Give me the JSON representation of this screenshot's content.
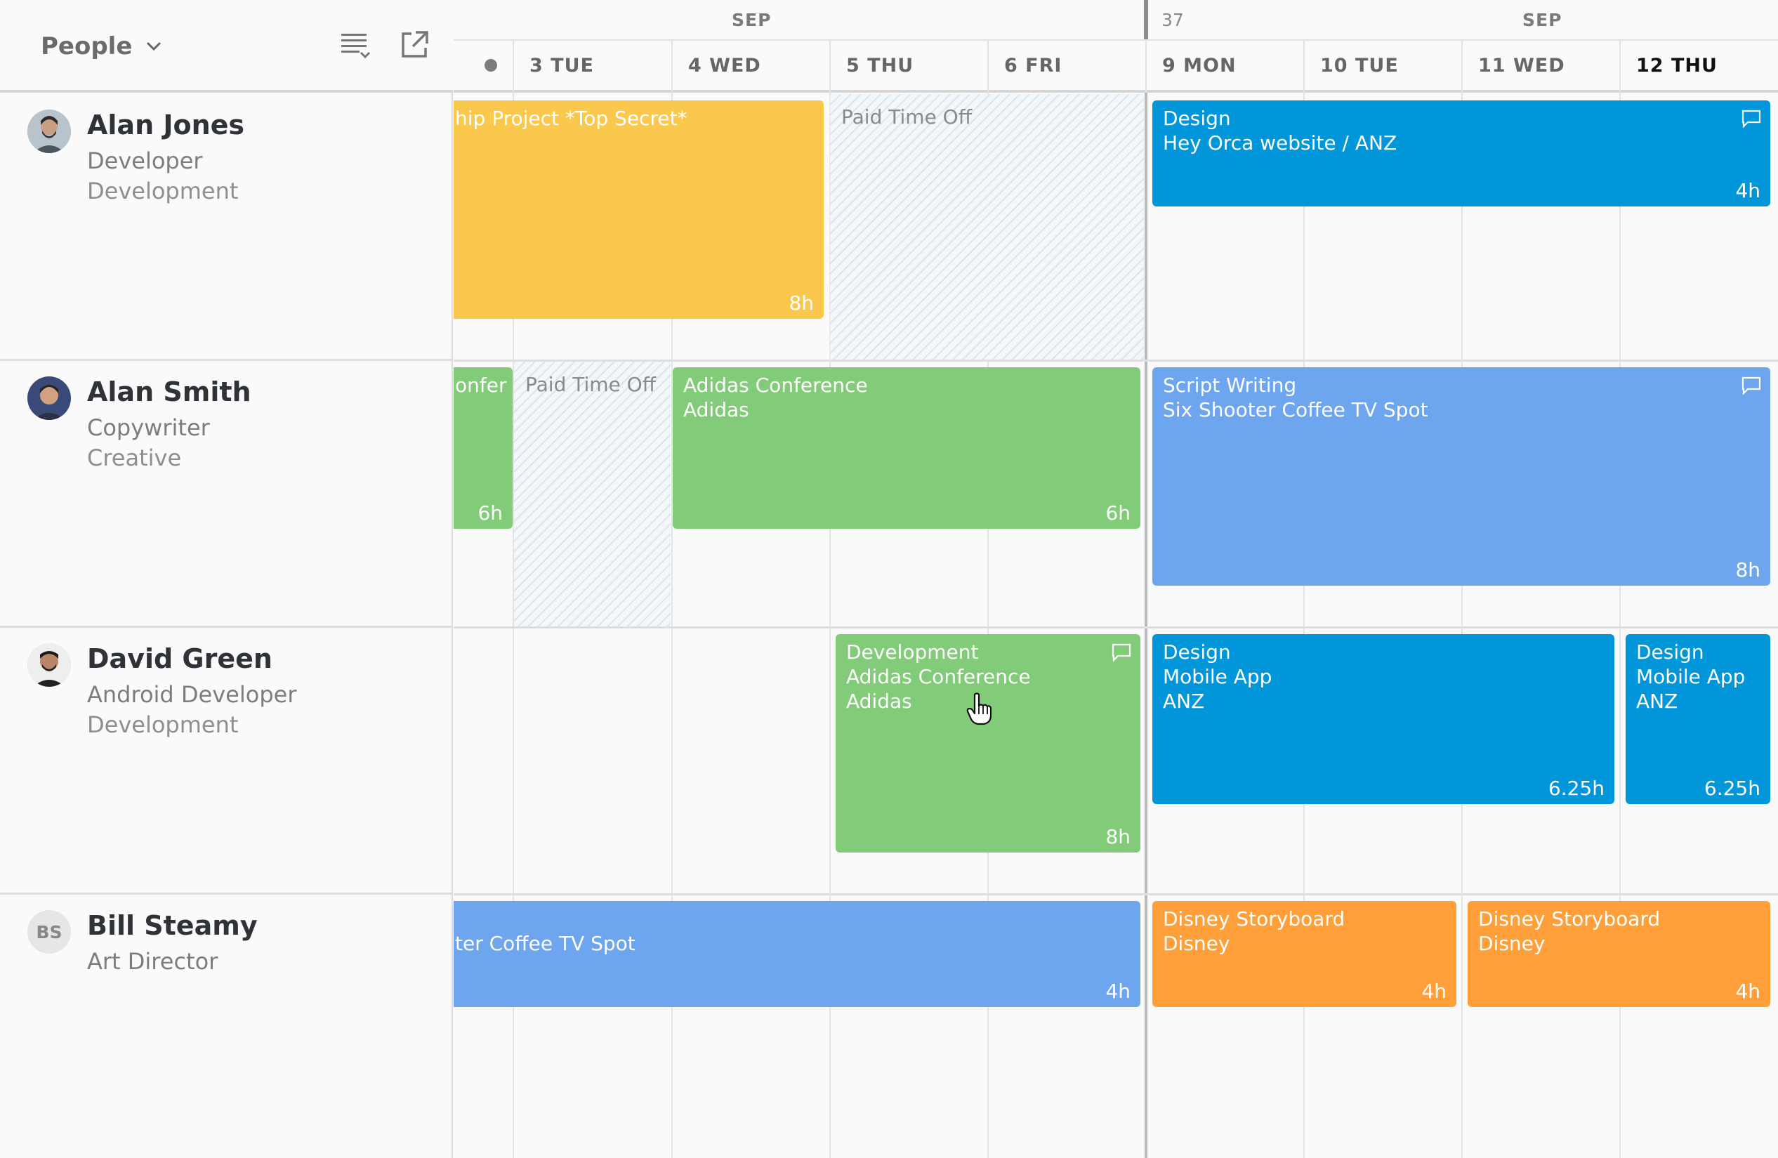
{
  "sidebar": {
    "view_select": "People",
    "people": [
      {
        "name": "Alan Jones",
        "role": "Developer",
        "department": "Development"
      },
      {
        "name": "Alan Smith",
        "role": "Copywriter",
        "department": "Creative"
      },
      {
        "name": "David Green",
        "role": "Android Developer",
        "department": "Development"
      },
      {
        "name": "Bill Steamy",
        "role": "Art Director",
        "initials": "BS"
      }
    ]
  },
  "header": {
    "month_left": "SEP",
    "month_right": "SEP",
    "week_number": "37",
    "days": [
      "3 TUE",
      "4 WED",
      "5 THU",
      "6 FRI",
      "9 MON",
      "10 TUE",
      "11 WED",
      "12 THU"
    ]
  },
  "tasks": {
    "jones_a": {
      "line1": "hip Project *Top Secret*",
      "hours": "8h"
    },
    "jones_pto": "Paid Time Off",
    "jones_b": {
      "line1": "Design",
      "line2": "Hey Orca website / ANZ",
      "hours": "4h"
    },
    "smith_a": {
      "line1": "onfer",
      "hours": "6h"
    },
    "smith_pto": "Paid Time Off",
    "smith_b": {
      "line1": "Adidas Conference",
      "line2": "Adidas",
      "hours": "6h"
    },
    "smith_c": {
      "line1": "Script Writing",
      "line2": "Six Shooter Coffee TV Spot",
      "hours": "8h"
    },
    "green_a": {
      "line1": "Development",
      "line2": "Adidas Conference",
      "line3": "Adidas",
      "hours": "8h"
    },
    "green_b": {
      "line1": "Design",
      "line2": "Mobile App",
      "line3": "ANZ",
      "hours": "6.25h"
    },
    "green_c": {
      "line1": "Design",
      "line2": "Mobile App",
      "line3": "ANZ",
      "hours": "6.25h"
    },
    "steamy_a": {
      "line1": "ter Coffee TV Spot",
      "hours": "4h"
    },
    "steamy_b": {
      "line1": "Disney Storyboard",
      "line2": "Disney",
      "hours": "4h"
    },
    "steamy_c": {
      "line1": "Disney Storyboard",
      "line2": "Disney",
      "hours": "4h"
    }
  },
  "colors": {
    "yellow": "#fbc84e",
    "blue": "#0096d9",
    "light_blue": "#6ea5ef",
    "green": "#82cb78",
    "orange": "#ff9f3a"
  },
  "icons": [
    "chevron-down-icon",
    "list-view-icon",
    "external-link-icon",
    "comment-icon",
    "hand-cursor-icon"
  ]
}
